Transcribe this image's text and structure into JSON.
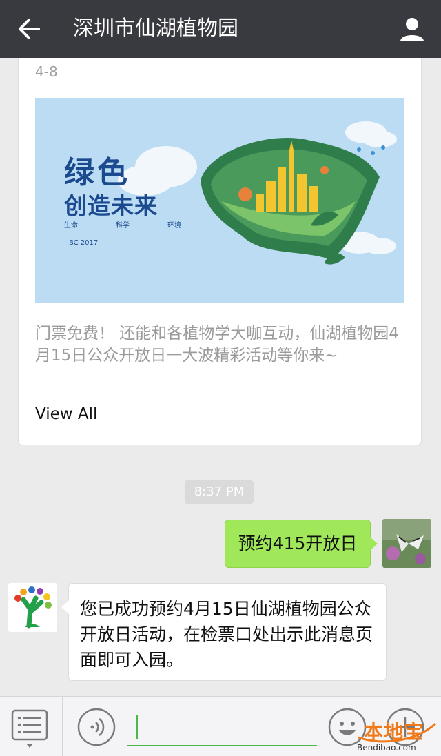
{
  "header": {
    "title": "深圳市仙湖植物园"
  },
  "article": {
    "date": "4-8",
    "banner": {
      "slogan_line1": "绿色",
      "slogan_line2": "创造未来",
      "sub_labels": [
        "生命",
        "科学",
        "环境"
      ],
      "logo_text": "IBC 2017"
    },
    "summary": "门票免费！ 还能和各植物学大咖互动，仙湖植物园4月15日公众开放日一大波精彩活动等你来~",
    "view_all_label": "View All"
  },
  "chat": {
    "timestamp": "8:37 PM",
    "outgoing_text": "预约415开放日",
    "incoming_text": "您已成功预约4月15日仙湖植物园公众开放日活动，在检票口处出示此消息页面即可入园。"
  },
  "watermark": {
    "text": "本地宝",
    "url": "Bendibao.com"
  },
  "colors": {
    "topbar": "#393a3f",
    "outgoing_bubble": "#a0e75a",
    "accent_green": "#4bb649",
    "banner_bg": "#bcdcf4"
  },
  "icons": [
    "back-arrow-icon",
    "person-icon",
    "menu-list-icon",
    "voice-icon",
    "emoji-icon",
    "plus-icon"
  ]
}
